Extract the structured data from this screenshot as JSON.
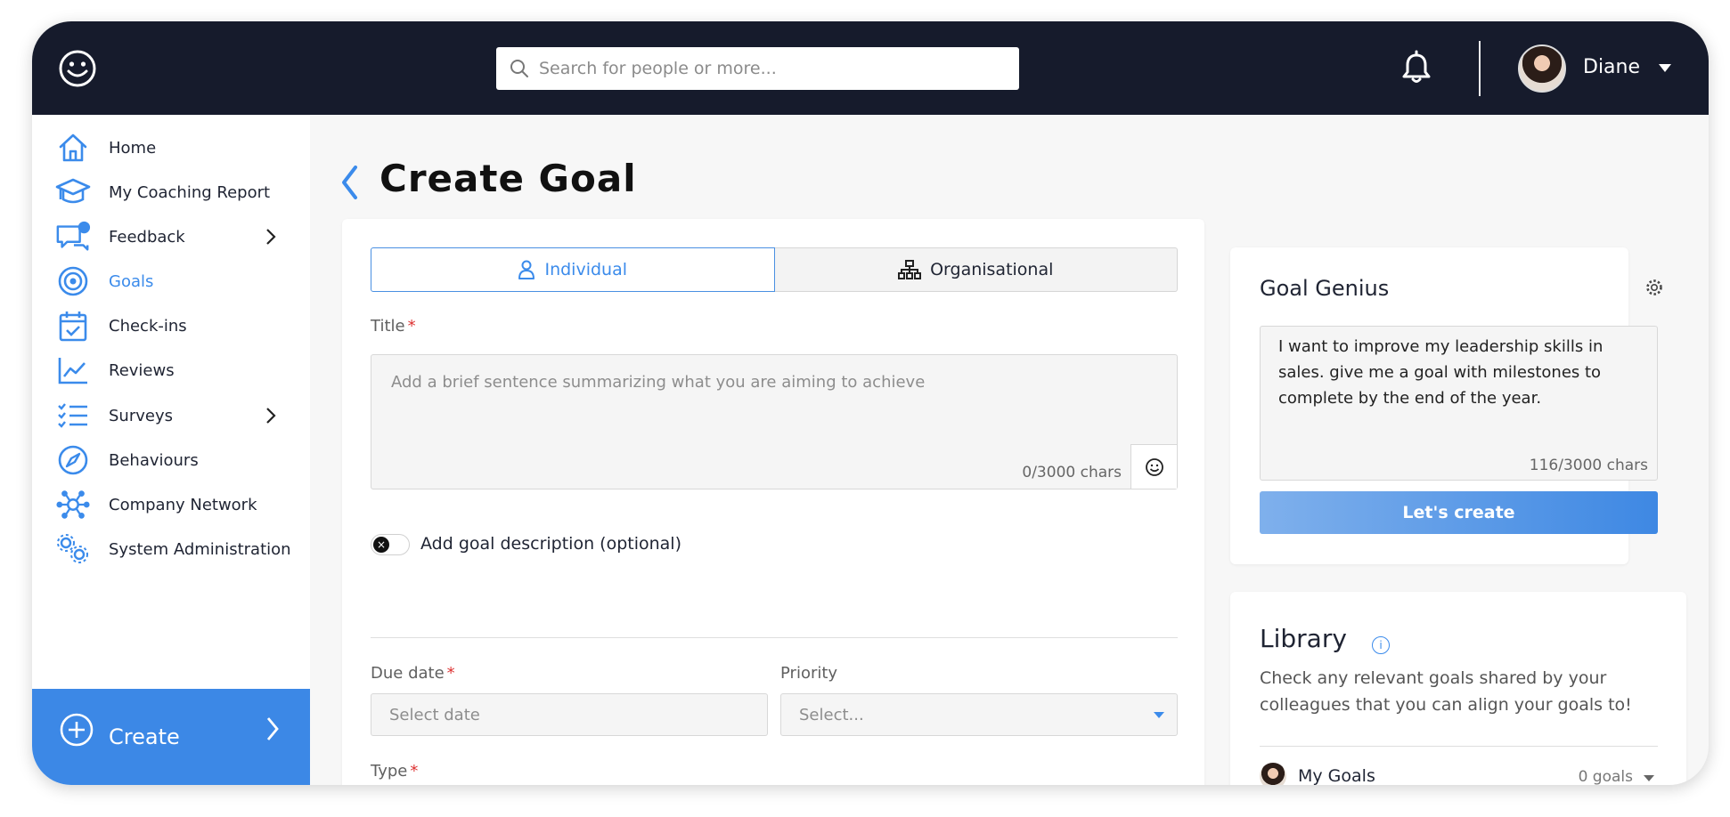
{
  "header": {
    "search_placeholder": "Search for people or more...",
    "user_name": "Diane"
  },
  "sidebar": {
    "items": [
      {
        "label": "Home",
        "icon": "home-icon"
      },
      {
        "label": "My Coaching Report",
        "icon": "graduation-cap-icon"
      },
      {
        "label": "Feedback",
        "icon": "chat-icon"
      },
      {
        "label": "Goals",
        "icon": "target-icon"
      },
      {
        "label": "Check-ins",
        "icon": "calendar-check-icon"
      },
      {
        "label": "Reviews",
        "icon": "line-chart-icon"
      },
      {
        "label": "Surveys",
        "icon": "checklist-icon"
      },
      {
        "label": "Behaviours",
        "icon": "compass-icon"
      },
      {
        "label": "Company Network",
        "icon": "network-icon"
      },
      {
        "label": "System Administration",
        "icon": "gears-icon"
      }
    ],
    "active_item": "Goals",
    "create_label": "Create"
  },
  "page": {
    "title": "Create Goal"
  },
  "form": {
    "tabs": [
      "Individual",
      "Organisational"
    ],
    "active_tab": "Individual",
    "title_label": "Title",
    "title_placeholder": "Add a brief sentence summarizing what you are aiming to achieve",
    "title_counter": "0/3000 chars",
    "description_toggle_label": "Add goal description (optional)",
    "due_date_label": "Due date",
    "due_date_placeholder": "Select date",
    "priority_label": "Priority",
    "priority_placeholder": "Select...",
    "type_label": "Type"
  },
  "genius": {
    "title": "Goal Genius",
    "prompt_text": "I want to improve my leadership skills in sales. give me a goal with milestones to complete by the end of the year.",
    "counter": "116/3000 chars",
    "button_label": "Let's create"
  },
  "library": {
    "title": "Library",
    "info_symbol": "i",
    "description": "Check any relevant goals shared by your colleagues that you can align your goals to!",
    "my_goals_label": "My Goals",
    "my_goals_count": "0 goals"
  },
  "colors": {
    "topbar": "#161b2c",
    "accent": "#3b8beb",
    "create_bg": "#3c88e6",
    "required": "#dd3333"
  }
}
